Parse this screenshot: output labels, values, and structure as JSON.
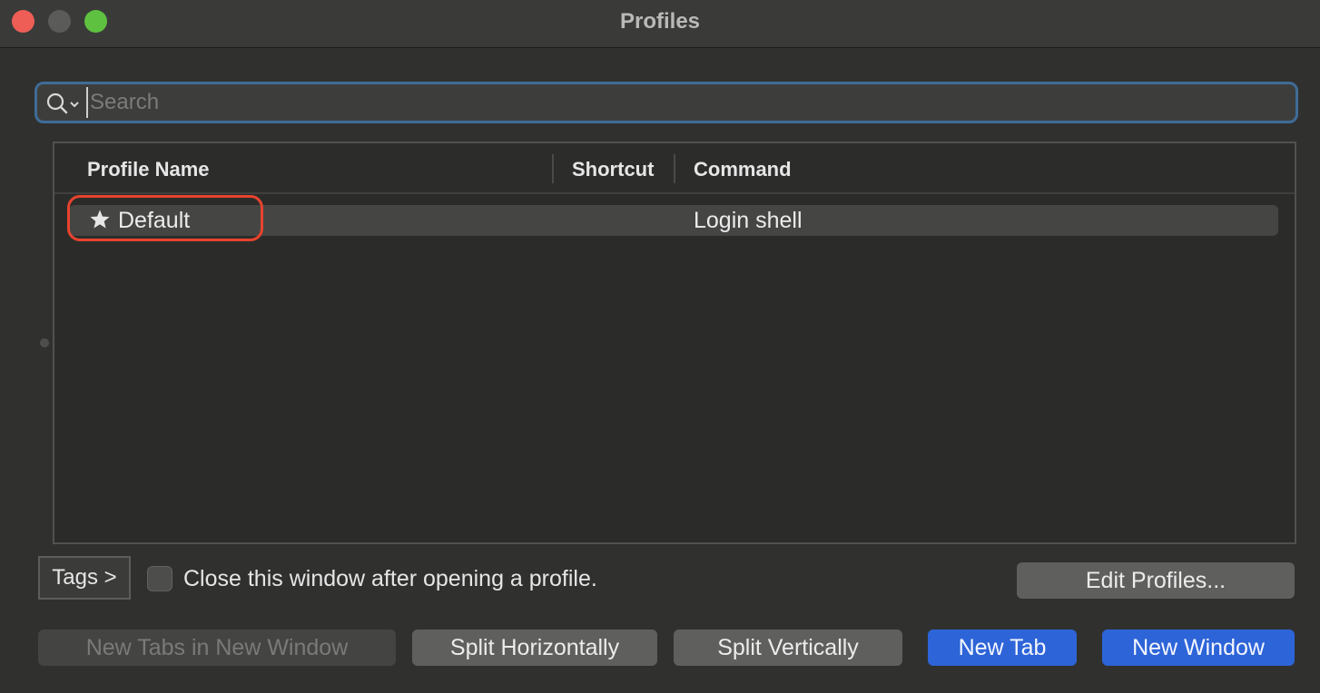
{
  "window": {
    "title": "Profiles"
  },
  "search": {
    "placeholder": "Search",
    "value": ""
  },
  "table": {
    "headers": {
      "name": "Profile Name",
      "shortcut": "Shortcut",
      "command": "Command"
    },
    "rows": [
      {
        "name": "Default",
        "shortcut": "",
        "command": "Login shell",
        "icon": "star-icon"
      }
    ]
  },
  "controls": {
    "tags_label": "Tags >",
    "close_after_open_label": "Close this window after opening a profile.",
    "close_after_open_checked": false,
    "edit_profiles_label": "Edit Profiles...",
    "new_tabs_in_new_window_label": "New Tabs in New Window",
    "split_horizontally_label": "Split Horizontally",
    "split_vertically_label": "Split Vertically",
    "new_tab_label": "New Tab",
    "new_window_label": "New Window"
  },
  "colors": {
    "accent_blue": "#2d64d8",
    "focus_ring": "#3f6c97",
    "annotation_red": "#e8432e",
    "close_red": "#ee5e56",
    "zoom_green": "#5fc140"
  }
}
